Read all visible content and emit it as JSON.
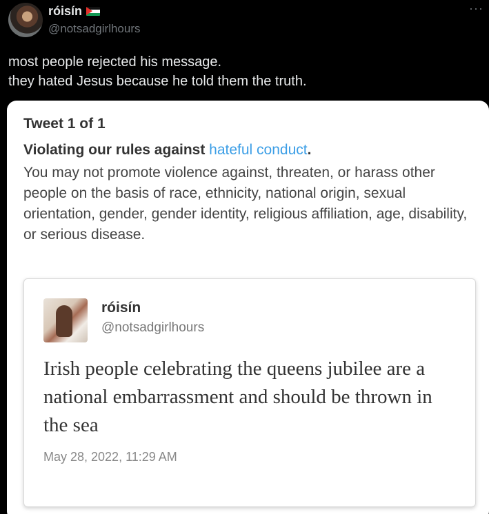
{
  "author": {
    "name": "róisín",
    "handle": "@notsadgirlhours",
    "flag_icon": "palestine-flag-icon"
  },
  "more_label": "···",
  "tweet": {
    "lines": [
      "most people rejected his message.",
      "they hated Jesus because he told them the truth."
    ]
  },
  "notice": {
    "title": "Tweet 1 of 1",
    "violation_prefix": "Violating our rules against ",
    "violation_link": "hateful conduct",
    "violation_suffix": ".",
    "rule_text": "You may not promote violence against, threaten, or harass other people on the basis of race, ethnicity, national origin, sexual orientation, gender, gender identity, religious affiliation, age, disability, or serious disease."
  },
  "embedded_tweet": {
    "name": "róisín",
    "handle": "@notsadgirlhours",
    "text": "Irish people celebrating the queens jubilee are a national embarrassment and should be thrown in the sea",
    "date": "May 28, 2022, 11:29 AM"
  },
  "colors": {
    "background": "#000000",
    "link": "#3b9ee6",
    "card": "#ffffff"
  }
}
